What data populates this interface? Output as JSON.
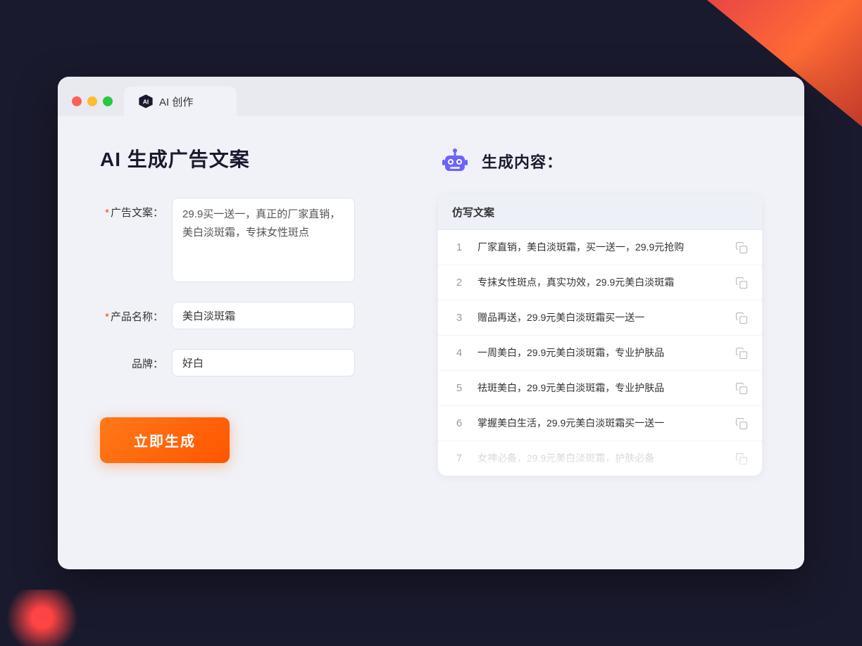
{
  "window": {
    "tab_title": "AI 创作"
  },
  "page": {
    "title": "AI 生成广告文案",
    "form": {
      "ad_copy_label": "广告文案：",
      "ad_copy_required": "*",
      "ad_copy_value": "29.9买一送一，真正的厂家直销，美白淡斑霜，专抹女性斑点",
      "product_name_label": "产品名称：",
      "product_name_required": "*",
      "product_name_value": "美白淡斑霜",
      "brand_label": "品牌：",
      "brand_value": "好白",
      "generate_button": "立即生成"
    },
    "results": {
      "header_icon_alt": "robot-icon",
      "title": "生成内容：",
      "table_header": "仿写文案",
      "rows": [
        {
          "num": "1",
          "text": "厂家直销，美白淡斑霜，买一送一，29.9元抢购",
          "muted": false
        },
        {
          "num": "2",
          "text": "专抹女性斑点，真实功效，29.9元美白淡斑霜",
          "muted": false
        },
        {
          "num": "3",
          "text": "赠品再送，29.9元美白淡斑霜买一送一",
          "muted": false
        },
        {
          "num": "4",
          "text": "一周美白，29.9元美白淡斑霜，专业护肤品",
          "muted": false
        },
        {
          "num": "5",
          "text": "祛斑美白，29.9元美白淡斑霜，专业护肤品",
          "muted": false
        },
        {
          "num": "6",
          "text": "掌握美白生活，29.9元美白淡斑霜买一送一",
          "muted": false
        },
        {
          "num": "7",
          "text": "女神必备，29.9元美白淡斑霜，护肤必备",
          "muted": true
        }
      ]
    }
  }
}
